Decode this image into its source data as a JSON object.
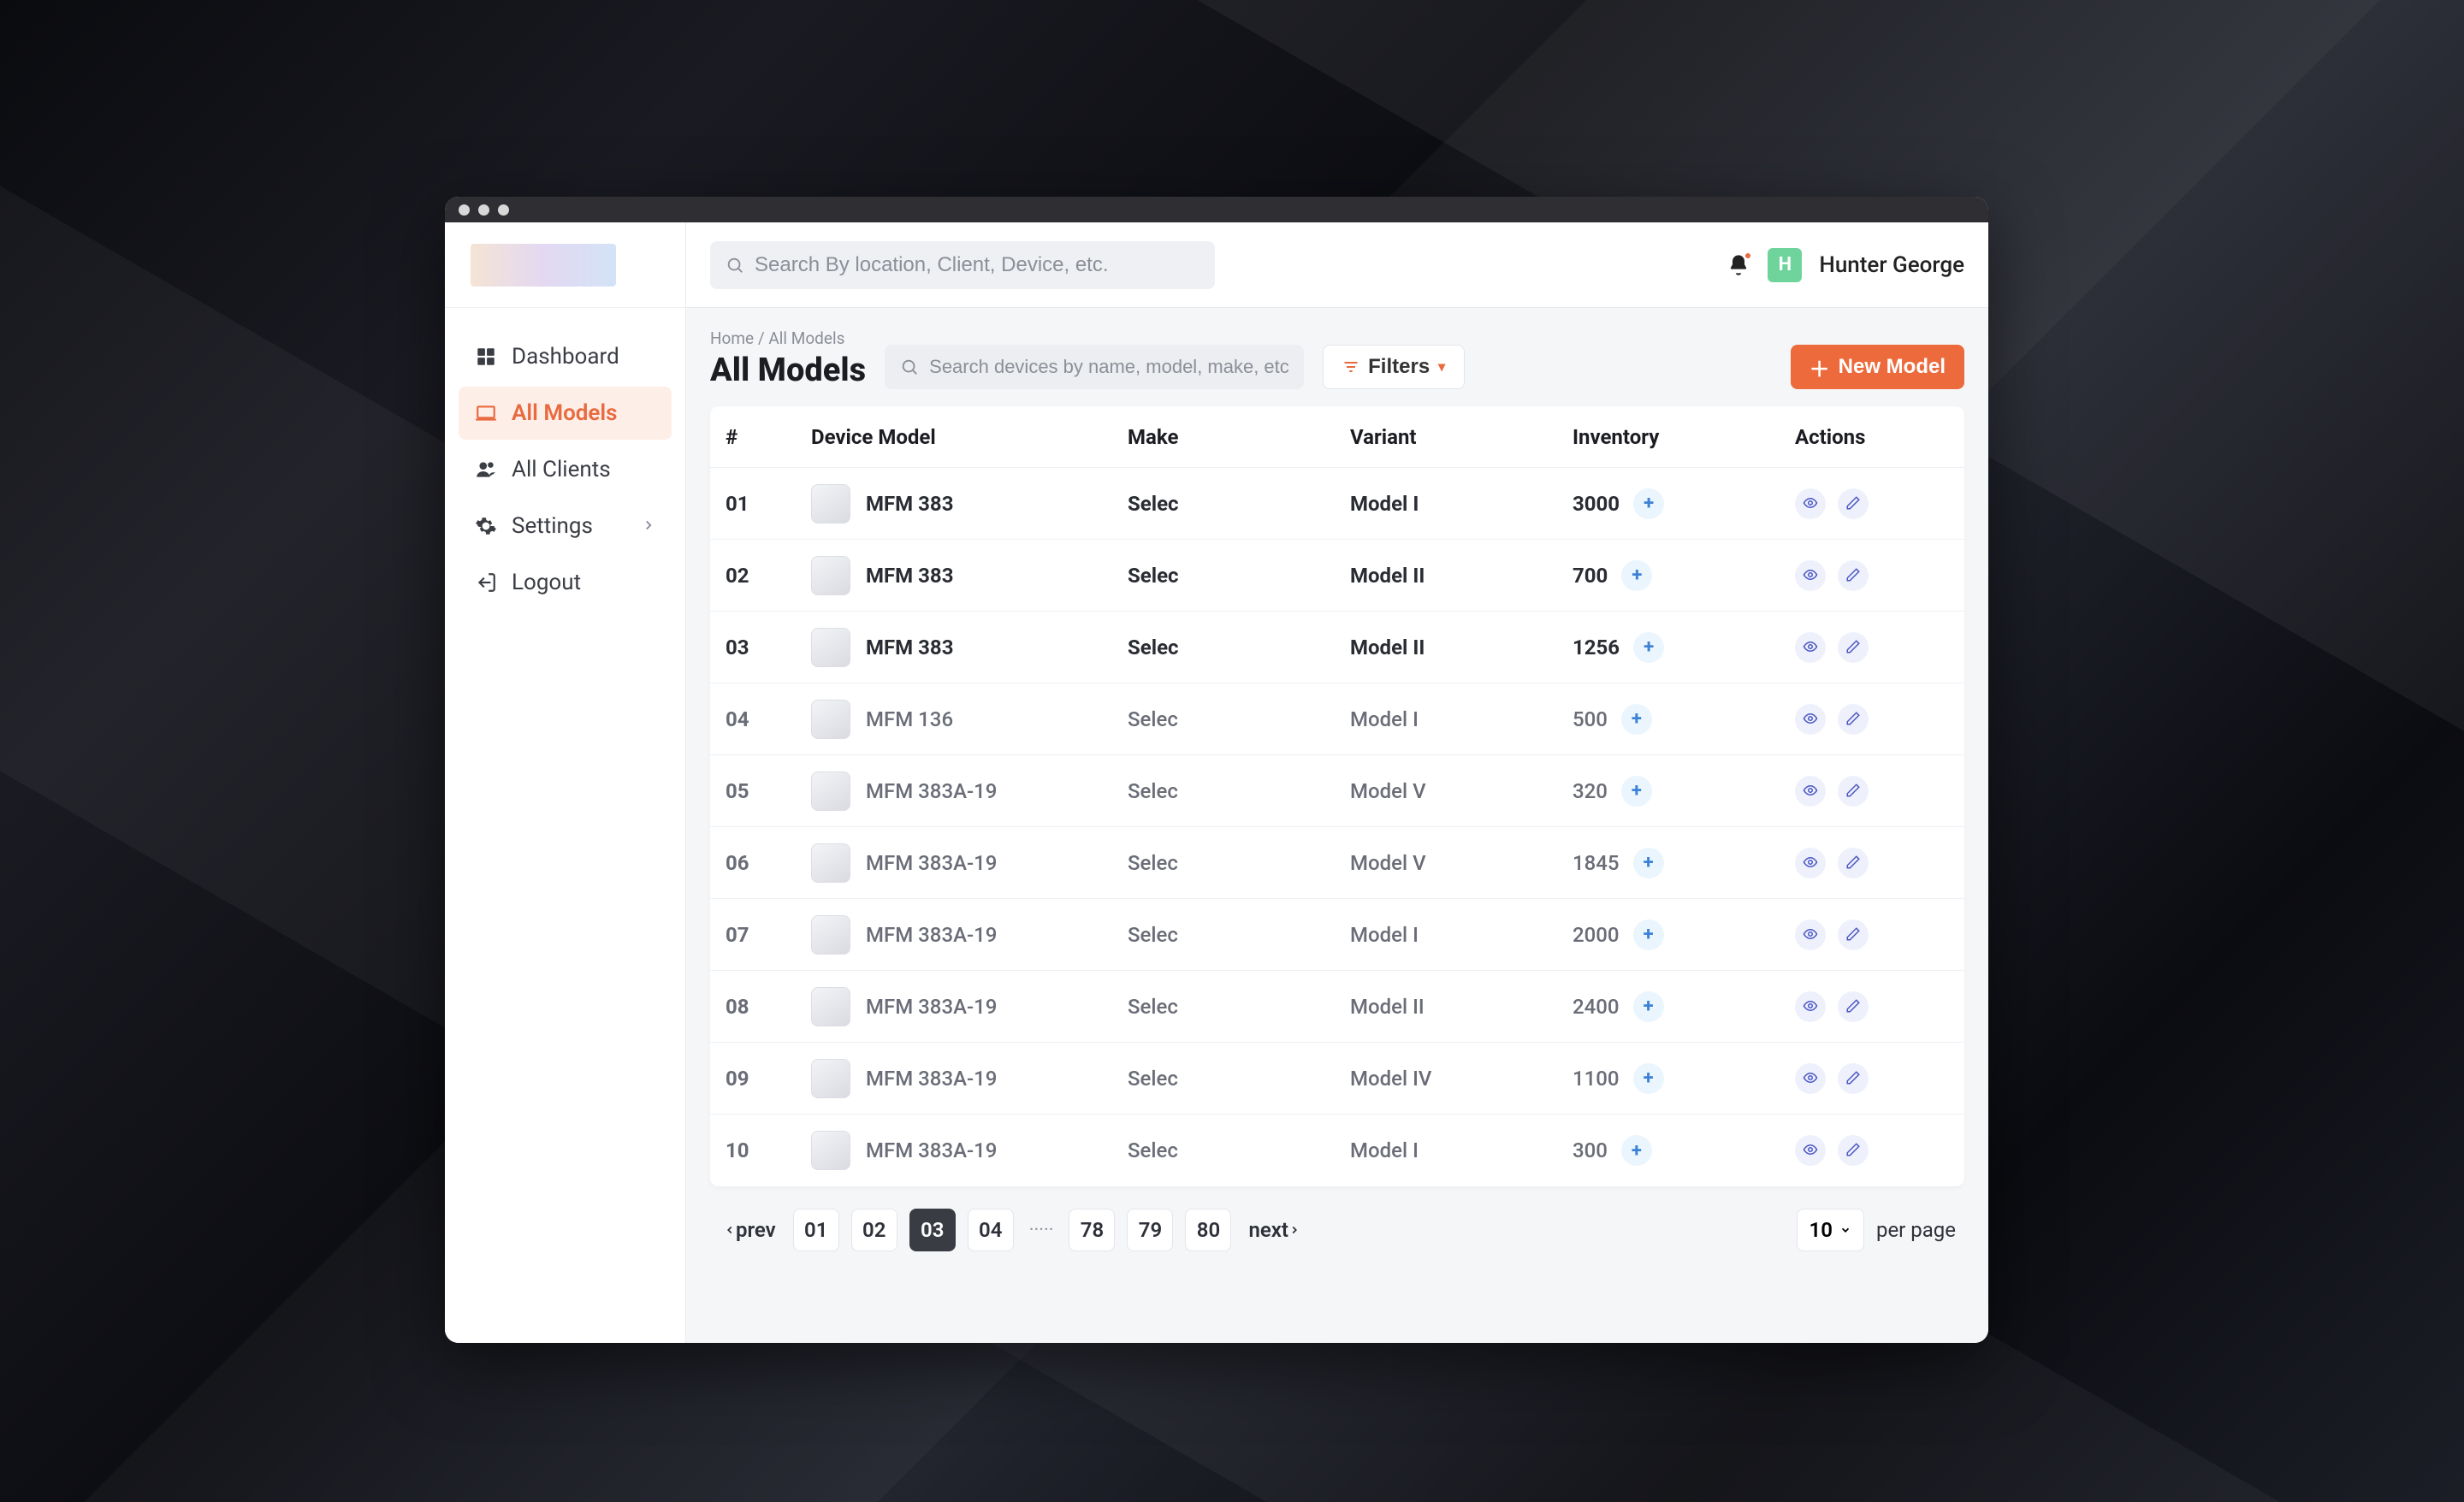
{
  "user": {
    "name": "Hunter George",
    "initial": "H"
  },
  "search": {
    "main_placeholder": "Search By location, Client, Device, etc.",
    "table_placeholder": "Search devices by name, model, make, etc"
  },
  "sidebar": {
    "items": [
      {
        "label": "Dashboard"
      },
      {
        "label": "All Models"
      },
      {
        "label": "All Clients"
      },
      {
        "label": "Settings"
      },
      {
        "label": "Logout"
      }
    ]
  },
  "breadcrumb": "Home / All Models",
  "page_title": "All Models",
  "buttons": {
    "filters": "Filters",
    "new_model": "New Model",
    "prev": "prev",
    "next": "next",
    "per_page": "per page"
  },
  "columns": {
    "index": "#",
    "device_model": "Device Model",
    "make": "Make",
    "variant": "Variant",
    "inventory": "Inventory",
    "actions": "Actions"
  },
  "rows": [
    {
      "idx": "01",
      "model": "MFM 383",
      "make": "Selec",
      "variant": "Model I",
      "inventory": "3000",
      "bold": true
    },
    {
      "idx": "02",
      "model": "MFM 383",
      "make": "Selec",
      "variant": "Model II",
      "inventory": "700",
      "bold": true
    },
    {
      "idx": "03",
      "model": "MFM 383",
      "make": "Selec",
      "variant": "Model II",
      "inventory": "1256",
      "bold": true
    },
    {
      "idx": "04",
      "model": "MFM 136",
      "make": "Selec",
      "variant": "Model I",
      "inventory": "500",
      "bold": false
    },
    {
      "idx": "05",
      "model": "MFM 383A-19",
      "make": "Selec",
      "variant": "Model V",
      "inventory": "320",
      "bold": false
    },
    {
      "idx": "06",
      "model": "MFM 383A-19",
      "make": "Selec",
      "variant": "Model V",
      "inventory": "1845",
      "bold": false
    },
    {
      "idx": "07",
      "model": "MFM 383A-19",
      "make": "Selec",
      "variant": "Model I",
      "inventory": "2000",
      "bold": false
    },
    {
      "idx": "08",
      "model": "MFM 383A-19",
      "make": "Selec",
      "variant": "Model II",
      "inventory": "2400",
      "bold": false
    },
    {
      "idx": "09",
      "model": "MFM 383A-19",
      "make": "Selec",
      "variant": "Model IV",
      "inventory": "1100",
      "bold": false
    },
    {
      "idx": "10",
      "model": "MFM 383A-19",
      "make": "Selec",
      "variant": "Model I",
      "inventory": "300",
      "bold": false
    }
  ],
  "pagination": {
    "pages_left": [
      "01",
      "02",
      "03",
      "04"
    ],
    "active": "03",
    "pages_right": [
      "78",
      "79",
      "80"
    ],
    "per_page_value": "10"
  }
}
